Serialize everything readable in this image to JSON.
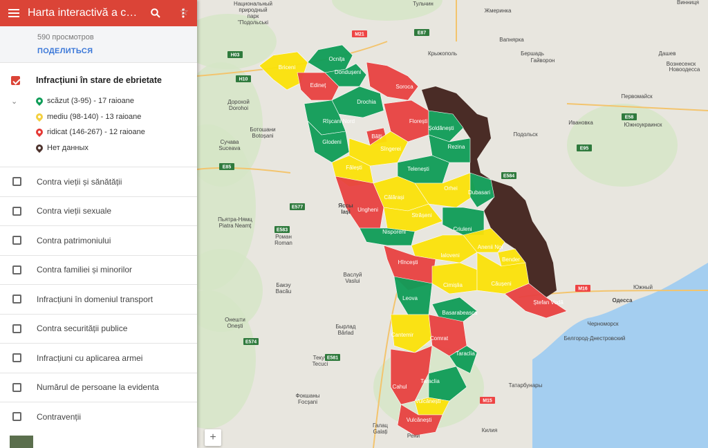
{
  "header": {
    "title": "Harta interactivă a con...",
    "menu_icon": "menu-icon",
    "search_icon": "search-icon",
    "more_icon": "more-vert-icon"
  },
  "meta": {
    "views": "590 просмотров",
    "share": "ПОДЕЛИТЬСЯ"
  },
  "active_layer": {
    "title": "Infracțiuni în stare de ebrietate",
    "legend": [
      {
        "label": "scăzut (3-95) - 17 raioane",
        "color": "#0f9d58"
      },
      {
        "label": "mediu (98-140) - 13 raioane",
        "color": "#f4d03f"
      },
      {
        "label": "ridicat (146-267) - 12 raioane",
        "color": "#e53935"
      },
      {
        "label": "Нет данных",
        "color": "#4e342e"
      }
    ]
  },
  "layers": [
    "Contra vieții și sănătății",
    "Contra vieții sexuale",
    "Contra patrimoniului",
    "Contra familiei și minorilor",
    "Infracțiuni în domeniul transport",
    "Contra securității publice",
    "Infracțiuni cu aplicarea armei",
    "Numărul de persoane la evidenta",
    "Contravenții"
  ],
  "map": {
    "colors": {
      "land": "#e8e6df",
      "sea": "#a4cef0",
      "green": "#0f9d58",
      "yellow": "#fbe20a",
      "red": "#e84242",
      "brown": "#4a2c26"
    },
    "districts": {
      "Briceni": "Briceni",
      "Ocnita": "Ocnița",
      "Edinet": "Edineț",
      "Donduseni": "Dondușeni",
      "Soroca": "Soroca",
      "Drochia": "Drochia",
      "Riscani": "Rîșcani Nord",
      "Glodeni": "Glodeni",
      "Balti": "Bălți",
      "Floresti": "Florești",
      "Soldanesti": "Șoldănești",
      "Singerei": "Sîngerei",
      "Rezina": "Rezina",
      "Falesti": "Fălești",
      "Telenesti": "Telenești",
      "Orhei": "Orhei",
      "Dubasari": "Dubasari",
      "Calarasi": "Călărași",
      "Ungheni": "Ungheni",
      "Straseni": "Strășeni",
      "Criuleni": "Criuleni",
      "Nisporeni": "Nisporeni",
      "Ialoveni": "Ialoveni",
      "AneniiNoi": "Anenii Noi",
      "Hincesti": "Hîncești",
      "Bender": "Bender",
      "Cimislia": "Cimișlia",
      "Causeni": "Căușeni",
      "Leova": "Leova",
      "StefanVoda": "Ștefan Vodă",
      "Basarabeasca": "Basarabeasca",
      "Cantemir": "Cantemir",
      "Comrat": "Comrat",
      "Taraclia": "Taraclia",
      "Cahul": "Cahul",
      "Vulcanesti": "Vulcănești",
      "Vulcanesti2": "Vulcănești"
    },
    "places": {
      "np": "Национальный\nприродный\nпарк\n\"Подольські",
      "vinnytsia_oblast": "Винниця",
      "zhmerynka": "Жмеринка",
      "dashev": "Дашев",
      "vapniarka": "Вапнярка",
      "bershad": "Бершадь",
      "gayvoron": "Гайворон",
      "pervomaysk": "Первомайск",
      "yuzhnoukrainsk": "Южноукраинск",
      "podolsk": "Подольск",
      "odessa": "Одесса",
      "bilhorod": "Белгород-Днестровский",
      "iasi": "Яссы\nIași",
      "botosani": "Ботошани\nBotoșani",
      "suceava": "Сучава\nSuceava",
      "dorohoi": "Дорохой\nDorohoi",
      "vaslui": "Васлуй\nVaslui",
      "barlad": "Бырлад\nBârlad",
      "bacau": "Бакэу\nBacău",
      "roman": "Роман\nRoman",
      "piatra": "Пьятра-Нямц\nPiatra Neamț",
      "focsani": "Фокшаны\nFocșani",
      "galati": "Галац\nGalați",
      "tecuci": "Текуч\nTecuci",
      "onesti": "Онешти\nOnești",
      "chernomorsk": "Черноморск",
      "kiliya": "Килия",
      "reni": "Рени",
      "tatarbunary": "Татарбунары",
      "yuzhny": "Южный",
      "ivanovka": "Ивановка",
      "tulchin": "Тульчин",
      "kryzhopil": "Крыжополь",
      "voznesensk": "Вознесенск",
      "novobug": "Новоодесса"
    },
    "roads": [
      "M21",
      "H03",
      "H10",
      "E85",
      "E58",
      "E583",
      "E581",
      "E574",
      "E95",
      "E584",
      "M16",
      "M15",
      "E87",
      "E577"
    ]
  }
}
